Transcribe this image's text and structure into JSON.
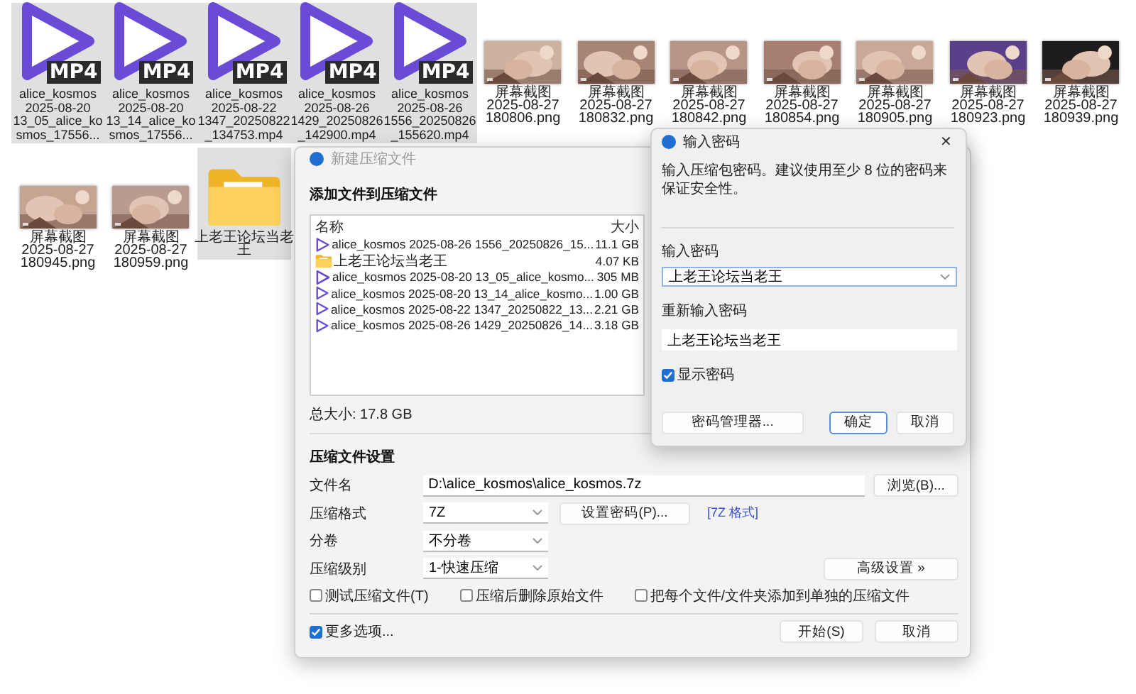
{
  "desktop": {
    "files": [
      {
        "kind": "video",
        "badge": "MP4",
        "selected": true,
        "label": [
          "alice_kosmos",
          "2025-08-20",
          "13_05_alice_ko",
          "smos_17556..."
        ]
      },
      {
        "kind": "video",
        "badge": "MP4",
        "selected": true,
        "label": [
          "alice_kosmos",
          "2025-08-20",
          "13_14_alice_ko",
          "smos_17556..."
        ]
      },
      {
        "kind": "video",
        "badge": "MP4",
        "selected": true,
        "label": [
          "alice_kosmos",
          "2025-08-22",
          "1347_20250822",
          "_134753.mp4"
        ]
      },
      {
        "kind": "video",
        "badge": "MP4",
        "selected": true,
        "label": [
          "alice_kosmos",
          "2025-08-26",
          "1429_20250826",
          "_142900.mp4"
        ]
      },
      {
        "kind": "video",
        "badge": "MP4",
        "selected": true,
        "label": [
          "alice_kosmos",
          "2025-08-26",
          "1556_20250826",
          "_155620.mp4"
        ]
      },
      {
        "selected": false,
        "label": [
          "屏幕截图",
          "2025-08-27",
          "180806.png"
        ]
      },
      {
        "selected": false,
        "label": [
          "屏幕截图",
          "2025-08-27",
          "180832.png"
        ]
      },
      {
        "selected": false,
        "label": [
          "屏幕截图",
          "2025-08-27",
          "180842.png"
        ]
      },
      {
        "selected": false,
        "label": [
          "屏幕截图",
          "2025-08-27",
          "180854.png"
        ]
      },
      {
        "selected": false,
        "label": [
          "屏幕截图",
          "2025-08-27",
          "180905.png"
        ]
      },
      {
        "selected": false,
        "label": [
          "屏幕截图",
          "2025-08-27",
          "180923.png"
        ]
      },
      {
        "selected": false,
        "label": [
          "屏幕截图",
          "2025-08-27",
          "180939.png"
        ]
      },
      {
        "selected": false,
        "label": [
          "屏幕截图",
          "2025-08-27",
          "180945.png"
        ]
      },
      {
        "selected": false,
        "label": [
          "屏幕截图",
          "2025-08-27",
          "180959.png"
        ]
      },
      {
        "kind": "folder",
        "selected": true,
        "label": [
          "上老王论坛当老",
          "王"
        ]
      }
    ]
  },
  "compress_dialog": {
    "title": "新建压缩文件",
    "heading": "添加文件到压缩文件",
    "columns": [
      "名称",
      "大小"
    ],
    "rows": [
      {
        "kind": "video",
        "name": "alice_kosmos 2025-08-26 1556_20250826_15...",
        "size": "11.1 GB"
      },
      {
        "kind": "folder",
        "name": "上老王论坛当老王",
        "size": "4.07 KB"
      },
      {
        "kind": "video",
        "name": "alice_kosmos 2025-08-20 13_05_alice_kosmo...",
        "size": "305 MB"
      },
      {
        "kind": "video",
        "name": "alice_kosmos 2025-08-20 13_14_alice_kosmo...",
        "size": "1.00 GB"
      },
      {
        "kind": "video",
        "name": "alice_kosmos 2025-08-22 1347_20250822_13...",
        "size": "2.21 GB"
      },
      {
        "kind": "video",
        "name": "alice_kosmos 2025-08-26 1429_20250826_14...",
        "size": "3.18 GB"
      }
    ],
    "total": "总大小: 17.8 GB",
    "settings_heading": "压缩文件设置",
    "filename": {
      "label": "文件名",
      "value": "D:\\alice_kosmos\\alice_kosmos.7z",
      "button": "浏览(B)..."
    },
    "format": {
      "label": "压缩格式",
      "value": "7Z",
      "button": "设置密码(P)...",
      "link": "[7Z 格式]"
    },
    "volume": {
      "label": "分卷",
      "value": "不分卷"
    },
    "level": {
      "label": "压缩级别",
      "value": "1-快速压缩",
      "button": "高级设置 »"
    },
    "options": [
      {
        "label": "测试压缩文件(T)",
        "checked": false
      },
      {
        "label": "压缩后删除原始文件",
        "checked": false
      },
      {
        "label": "把每个文件/文件夹添加到单独的压缩文件",
        "checked": false
      }
    ],
    "more_options": {
      "label": "更多选项...",
      "checked": true
    },
    "buttons": [
      "开始(S)",
      "取消"
    ]
  },
  "password_dialog": {
    "title": "输入密码",
    "close": "✕",
    "message": "输入压缩包密码。建议使用至少 8 位的密码来保证安全性。",
    "password_label": "输入密码",
    "password_value": "上老王论坛当老王",
    "confirm_label": "重新输入密码",
    "confirm_value": "上老王论坛当老王",
    "show_password": {
      "label": "显示密码",
      "checked": true
    },
    "buttons": [
      {
        "label": "密码管理器...",
        "focused": false
      },
      {
        "label": "确定",
        "focused": true
      },
      {
        "label": "取消",
        "focused": false
      }
    ]
  }
}
